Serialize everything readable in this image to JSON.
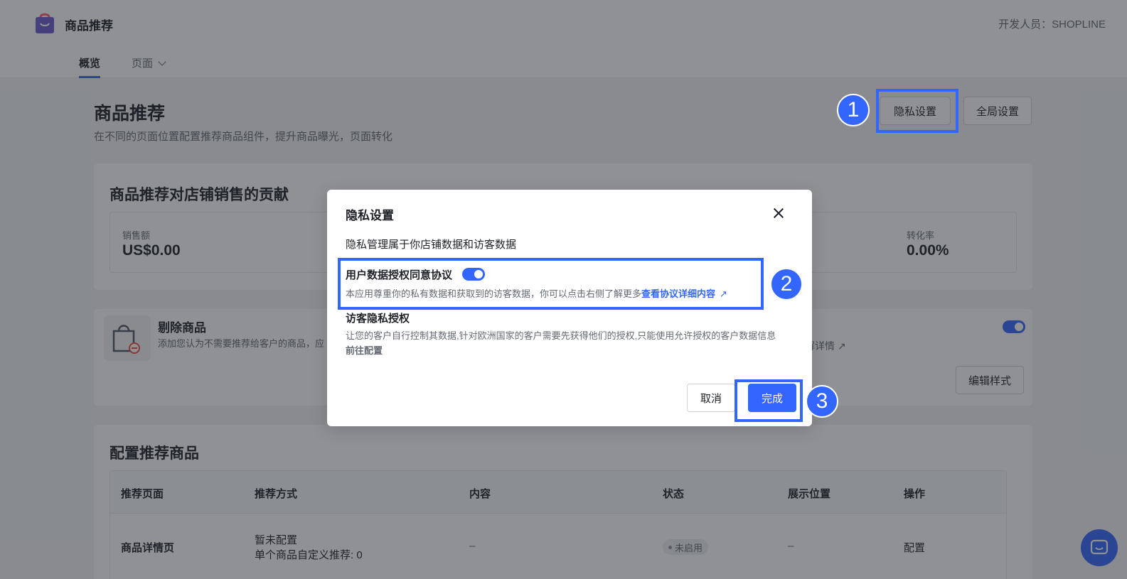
{
  "header": {
    "app_title": "商品推荐",
    "developer": "开发人员：SHOPLINE",
    "tabs": [
      {
        "label": "概览",
        "active": true
      },
      {
        "label": "页面",
        "active": false
      }
    ]
  },
  "page": {
    "title": "商品推荐",
    "subtitle": "在不同的页面位置配置推荐商品组件，提升商品曝光，页面转化",
    "privacy_button": "隐私设置",
    "global_button": "全局设置"
  },
  "contribution": {
    "title": "商品推荐对店铺销售的贡献",
    "metrics": [
      {
        "label": "销售额",
        "value": "US$0.00"
      },
      {
        "label": "转化率",
        "value": "0.00%"
      }
    ]
  },
  "remove_products": {
    "title": "剔除商品",
    "description": "添加您认为不需要推荐给客户的商品，应",
    "learn_more": "解详情",
    "edit_style": "编辑样式",
    "enabled": true
  },
  "config": {
    "title": "配置推荐商品",
    "columns": [
      "推荐页面",
      "推荐方式",
      "内容",
      "状态",
      "展示位置",
      "操作"
    ],
    "rows": [
      {
        "page": "商品详情页",
        "method_line1": "暂未配置",
        "method_line2": "单个商品自定义推荐: 0",
        "content": "–",
        "status": "未启用",
        "position": "–",
        "action": "配置"
      }
    ]
  },
  "dialog": {
    "title": "隐私设置",
    "intro": "隐私管理属于你店铺数据和访客数据",
    "agreement_title": "用户数据授权同意协议",
    "agreement_enabled": true,
    "agreement_desc": "本应用尊重你的私有数据和获取到的访客数据，你可以点击右侧了解更多",
    "agreement_link": "查看协议详细内容",
    "visitor_title": "访客隐私授权",
    "visitor_desc": "让您的客户自行控制其数据,针对欧洲国家的客户需要先获得他们的授权,只能使用允许授权的客户数据信息",
    "visitor_link": "前往配置",
    "cancel": "取消",
    "confirm": "完成"
  },
  "annotations": {
    "step1": "1",
    "step2": "2",
    "step3": "3",
    "accent": "#3366ff"
  }
}
